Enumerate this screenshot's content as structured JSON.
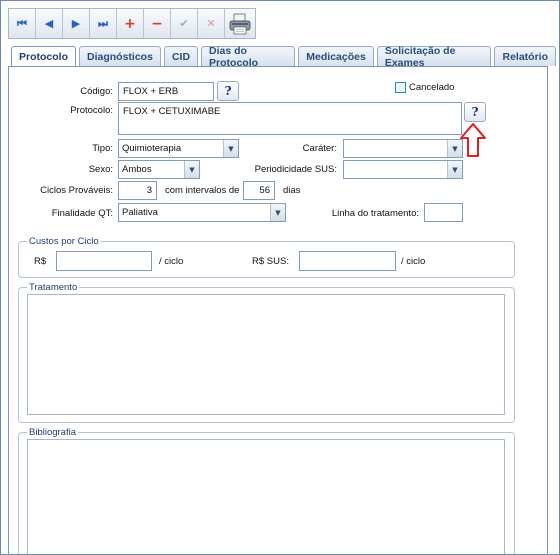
{
  "toolbar": {
    "first_icon": "⏮",
    "prev_icon": "◀",
    "next_icon": "▶",
    "last_icon": "⏭",
    "add_icon": "+",
    "remove_icon": "−",
    "confirm_icon": "✔",
    "cancel_icon": "✕",
    "print_icon": "🖨"
  },
  "tabs": [
    {
      "label": "Protocolo"
    },
    {
      "label": "Diagnósticos"
    },
    {
      "label": "CID"
    },
    {
      "label": "Dias do Protocolo"
    },
    {
      "label": "Medicações"
    },
    {
      "label": "Solicitação de Exames"
    },
    {
      "label": "Relatório"
    }
  ],
  "form": {
    "codigo_label": "Código:",
    "codigo_value": "FLOX + ERB",
    "cancelado_label": "Cancelado",
    "protocolo_label": "Protocolo:",
    "protocolo_value": "FLOX + CETUXIMABE",
    "help_label": "?",
    "tipo_label": "Tipo:",
    "tipo_value": "Quimioterapia",
    "carater_label": "Caráter:",
    "carater_value": "",
    "sexo_label": "Sexo:",
    "sexo_value": "Ambos",
    "periodicidade_label": "Periodicidade SUS:",
    "periodicidade_value": "",
    "ciclos_label": "Ciclos Prováveis:",
    "ciclos_value": "3",
    "intervalos_label": "com intervalos de",
    "intervalos_value": "56",
    "dias_label": "dias",
    "finalidade_label": "Finalidade QT:",
    "finalidade_value": "Paliativa",
    "linha_label": "Linha do tratamento:",
    "linha_value": ""
  },
  "custos": {
    "legend": "Custos por Ciclo",
    "rs_label": "R$",
    "rs_value": "",
    "ciclo_label": "/ ciclo",
    "rs_sus_label": "R$ SUS:",
    "rs_sus_value": "",
    "ciclo_sus_label": "/ ciclo"
  },
  "tratamento": {
    "legend": "Tratamento"
  },
  "bibliografia": {
    "legend": "Bibliografia"
  },
  "colors": {
    "accent": "#1e3f73",
    "annotation_arrow": "#e02020"
  }
}
